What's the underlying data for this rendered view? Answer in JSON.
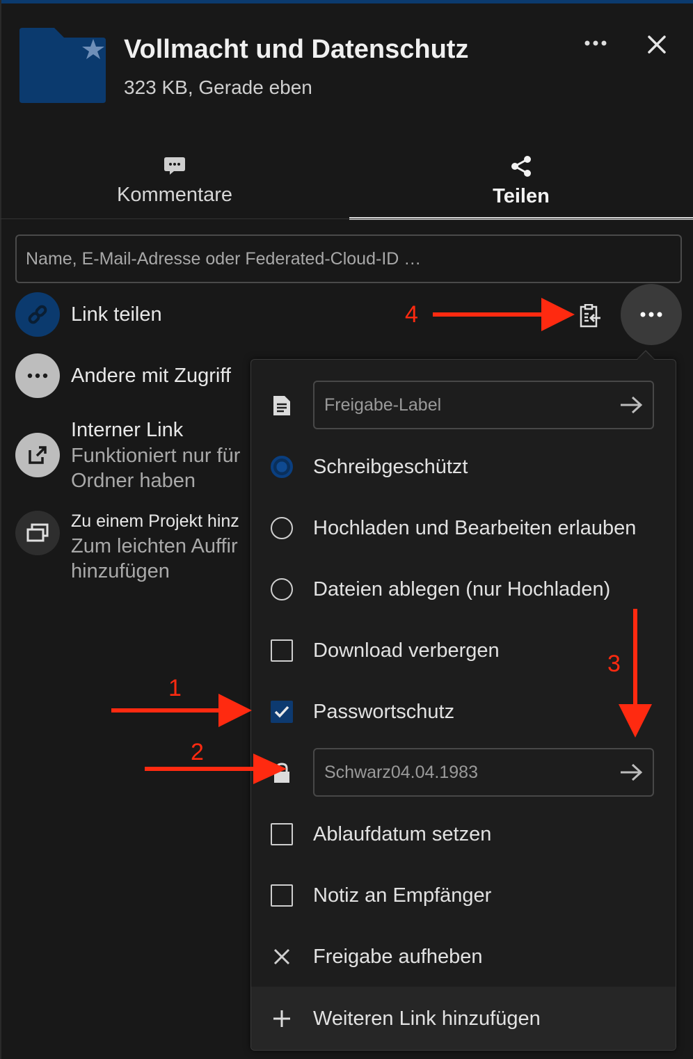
{
  "colors": {
    "background": "#181818",
    "accent": "#0b3a6e",
    "annotation": "#ff2a10"
  },
  "header": {
    "title": "Vollmacht und Datenschutz",
    "subtitle": "323 KB, Gerade eben",
    "folder_icon": "folder-star-icon",
    "more_icon": "more-horizontal-icon",
    "close_icon": "close-icon"
  },
  "tabs": [
    {
      "label": "Kommentare",
      "icon": "comment-icon",
      "active": false
    },
    {
      "label": "Teilen",
      "icon": "share-icon",
      "active": true
    }
  ],
  "search": {
    "placeholder": "Name, E-Mail-Adresse oder Federated-Cloud-ID …"
  },
  "share_list": {
    "link": {
      "label": "Link teilen",
      "icon": "link-icon"
    },
    "others": {
      "label": "Andere mit Zugriff",
      "icon": "more-horizontal-icon"
    },
    "internal": {
      "label": "Interner Link",
      "sub1": "Funktioniert nur für",
      "sub2": "Ordner haben",
      "icon": "external-link-icon"
    },
    "project": {
      "label": "Zu einem Projekt hinz",
      "sub1": "Zum leichten Auffir",
      "sub2": "hinzufügen",
      "icon": "project-icon"
    }
  },
  "menu": {
    "label_field": {
      "placeholder": "Freigabe-Label",
      "icon": "text-file-icon"
    },
    "options": [
      {
        "type": "radio",
        "label": "Schreibgeschützt",
        "checked": true
      },
      {
        "type": "radio",
        "label": "Hochladen und Bearbeiten erlauben",
        "checked": false
      },
      {
        "type": "radio",
        "label": "Dateien ablegen (nur Hochladen)",
        "checked": false
      },
      {
        "type": "checkbox",
        "label": "Download verbergen",
        "checked": false
      },
      {
        "type": "checkbox",
        "label": "Passwortschutz",
        "checked": true
      }
    ],
    "password_field": {
      "value": "Schwarz04.04.1983",
      "icon": "lock-icon"
    },
    "options2": [
      {
        "type": "checkbox",
        "label": "Ablaufdatum setzen",
        "checked": false
      },
      {
        "type": "checkbox",
        "label": "Notiz an Empfänger",
        "checked": false
      }
    ],
    "unshare": {
      "label": "Freigabe aufheben",
      "icon": "close-icon"
    },
    "add_link": {
      "label": "Weiteren Link hinzufügen",
      "icon": "plus-icon"
    }
  },
  "annotations": [
    "1",
    "2",
    "3",
    "4"
  ]
}
